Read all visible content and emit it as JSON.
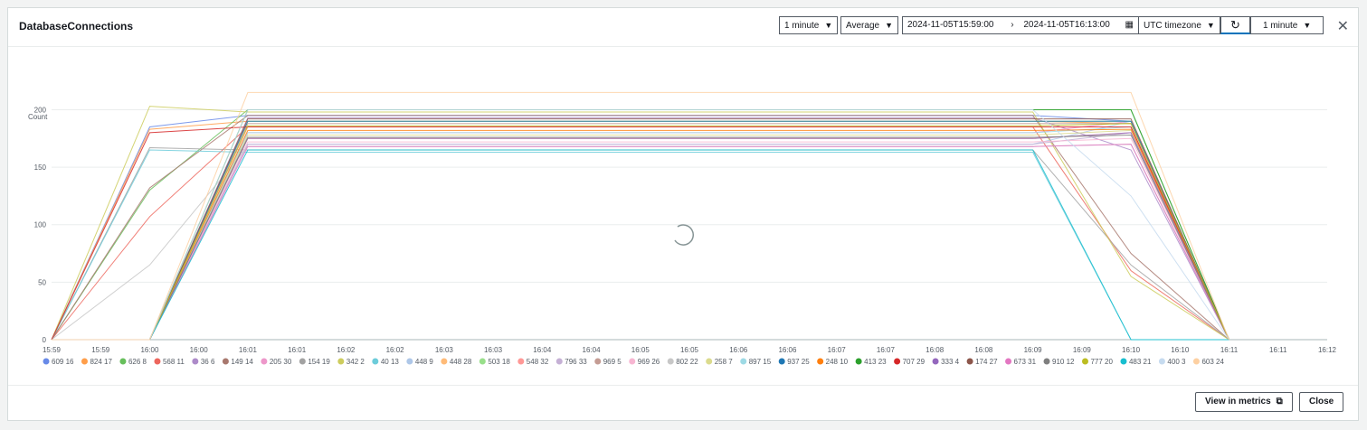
{
  "header": {
    "title": "DatabaseConnections",
    "period": "1 minute",
    "statistic": "Average",
    "range_start": "2024-11-05T15:59:00",
    "range_end": "2024-11-05T16:13:00",
    "timezone": "UTC timezone",
    "refresh_interval": "1 minute"
  },
  "footer": {
    "view_in_metrics": "View in metrics",
    "close": "Close"
  },
  "chart_data": {
    "type": "line",
    "ylabel": "Count",
    "ylim": [
      0,
      220
    ],
    "yticks": [
      0,
      50,
      100,
      150,
      200
    ],
    "x_tick_labels": [
      "15:59",
      "15:59",
      "16:00",
      "16:00",
      "16:01",
      "16:01",
      "16:02",
      "16:02",
      "16:03",
      "16:03",
      "16:04",
      "16:04",
      "16:05",
      "16:05",
      "16:06",
      "16:06",
      "16:07",
      "16:07",
      "16:08",
      "16:08",
      "16:09",
      "16:09",
      "16:10",
      "16:10",
      "16:11",
      "16:11",
      "16:12"
    ],
    "x": [
      "15:59",
      "16:00",
      "16:01",
      "16:09",
      "16:10",
      "16:11"
    ],
    "grid": true,
    "legend_position": "bottom",
    "series": [
      {
        "name": "609 16",
        "color": "#688ae8",
        "values": [
          0,
          185,
          195,
          195,
          190,
          0
        ]
      },
      {
        "name": "824 17",
        "color": "#ff9e4a",
        "values": [
          0,
          183,
          190,
          190,
          188,
          0
        ]
      },
      {
        "name": "626 8",
        "color": "#67bf5c",
        "values": [
          0,
          130,
          200,
          200,
          200,
          0
        ]
      },
      {
        "name": "568 11",
        "color": "#ed665d",
        "values": [
          0,
          107,
          185,
          185,
          60,
          0
        ]
      },
      {
        "name": "36 6",
        "color": "#ad8bc9",
        "values": [
          0,
          0,
          193,
          193,
          165,
          0
        ]
      },
      {
        "name": "149 14",
        "color": "#a8786e",
        "values": [
          0,
          132,
          195,
          195,
          75,
          0
        ]
      },
      {
        "name": "205 30",
        "color": "#ed97ca",
        "values": [
          0,
          0,
          180,
          180,
          190,
          0
        ]
      },
      {
        "name": "154 19",
        "color": "#a2a2a2",
        "values": [
          0,
          167,
          165,
          165,
          65,
          0
        ]
      },
      {
        "name": "342 2",
        "color": "#cdcc5d",
        "values": [
          0,
          203,
          198,
          198,
          55,
          0
        ]
      },
      {
        "name": "40 13",
        "color": "#6dccda",
        "values": [
          0,
          165,
          163,
          163,
          0,
          0
        ]
      },
      {
        "name": "448 9",
        "color": "#aec7e8",
        "values": [
          0,
          0,
          170,
          170,
          190,
          0
        ]
      },
      {
        "name": "448 28",
        "color": "#ffbb78",
        "values": [
          0,
          0,
          175,
          175,
          180,
          0
        ]
      },
      {
        "name": "503 18",
        "color": "#98df8a",
        "values": [
          0,
          0,
          190,
          190,
          190,
          0
        ]
      },
      {
        "name": "548 32",
        "color": "#ff9896",
        "values": [
          0,
          0,
          185,
          185,
          185,
          0
        ]
      },
      {
        "name": "796 33",
        "color": "#c5b0d5",
        "values": [
          0,
          0,
          170,
          170,
          180,
          0
        ]
      },
      {
        "name": "969 5",
        "color": "#c49c94",
        "values": [
          0,
          0,
          188,
          188,
          188,
          0
        ]
      },
      {
        "name": "969 26",
        "color": "#f7b6d2",
        "values": [
          0,
          0,
          172,
          172,
          175,
          0
        ]
      },
      {
        "name": "802 22",
        "color": "#c7c7c7",
        "values": [
          0,
          65,
          168,
          168,
          170,
          0
        ]
      },
      {
        "name": "258 7",
        "color": "#dbdb8d",
        "values": [
          0,
          0,
          178,
          178,
          182,
          0
        ]
      },
      {
        "name": "897 15",
        "color": "#9edae5",
        "values": [
          0,
          0,
          180,
          180,
          185,
          0
        ]
      },
      {
        "name": "937 25",
        "color": "#1f77b4",
        "values": [
          0,
          0,
          190,
          190,
          190,
          0
        ]
      },
      {
        "name": "248 10",
        "color": "#ff7f0e",
        "values": [
          0,
          0,
          182,
          182,
          183,
          0
        ]
      },
      {
        "name": "413 23",
        "color": "#2ca02c",
        "values": [
          0,
          0,
          200,
          200,
          200,
          0
        ]
      },
      {
        "name": "707 29",
        "color": "#d62728",
        "values": [
          0,
          180,
          185,
          185,
          185,
          0
        ]
      },
      {
        "name": "333 4",
        "color": "#9467bd",
        "values": [
          0,
          0,
          175,
          175,
          180,
          0
        ]
      },
      {
        "name": "174 27",
        "color": "#8c564b",
        "values": [
          0,
          0,
          192,
          192,
          192,
          0
        ]
      },
      {
        "name": "673 31",
        "color": "#e377c2",
        "values": [
          0,
          0,
          168,
          168,
          170,
          0
        ]
      },
      {
        "name": "910 12",
        "color": "#7f7f7f",
        "values": [
          0,
          0,
          176,
          176,
          178,
          0
        ]
      },
      {
        "name": "777 20",
        "color": "#bcbd22",
        "values": [
          0,
          0,
          186,
          186,
          188,
          0
        ]
      },
      {
        "name": "483 21",
        "color": "#17becf",
        "values": [
          0,
          0,
          165,
          165,
          0,
          0
        ]
      },
      {
        "name": "400 3",
        "color": "#c6dbef",
        "values": [
          0,
          0,
          200,
          200,
          125,
          0
        ]
      },
      {
        "name": "603 24",
        "color": "#fdd0a2",
        "values": [
          0,
          0,
          215,
          215,
          215,
          0
        ]
      }
    ]
  }
}
